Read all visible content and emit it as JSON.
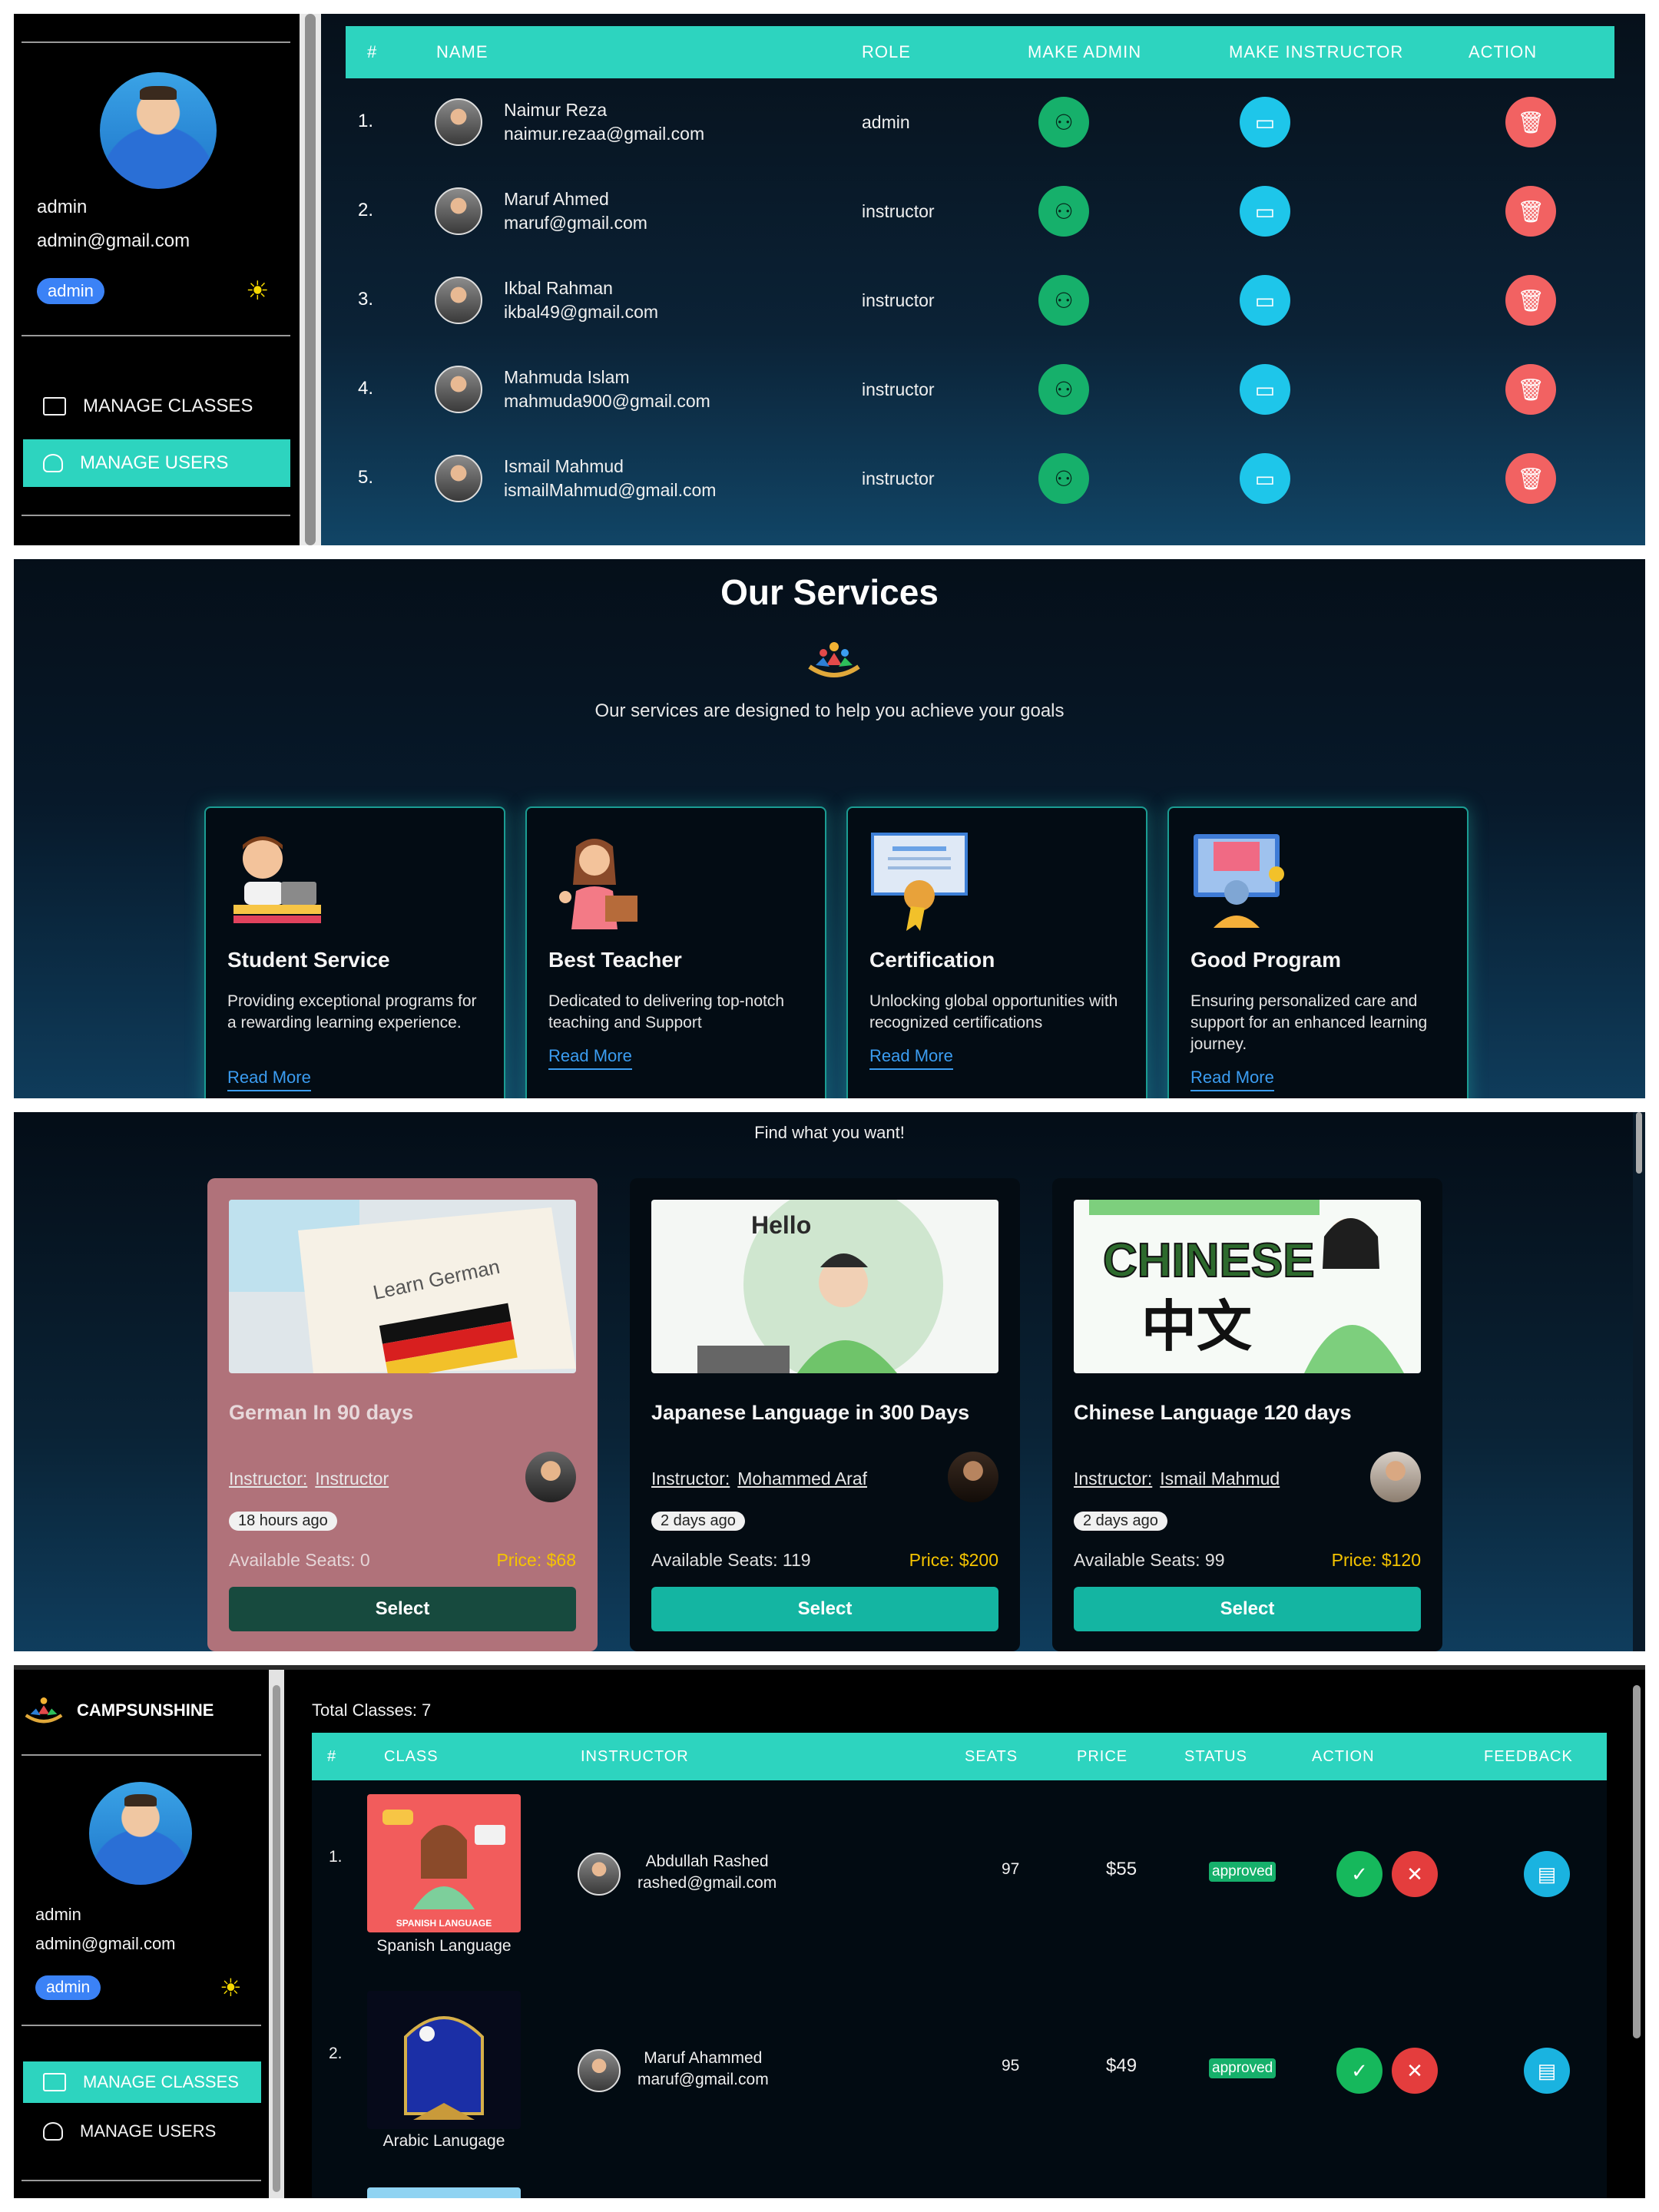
{
  "users_panel": {
    "sidebar": {
      "user_name": "admin",
      "user_email": "admin@gmail.com",
      "role_badge": "admin",
      "theme_icon": "sun-icon",
      "nav": [
        {
          "label": "MANAGE CLASSES",
          "icon": "classes-icon",
          "active": false
        },
        {
          "label": "MANAGE USERS",
          "icon": "users-icon",
          "active": true
        }
      ]
    },
    "table": {
      "headers": [
        "#",
        "NAME",
        "ROLE",
        "MAKE ADMIN",
        "MAKE INSTRUCTOR",
        "ACTION"
      ],
      "rows": [
        {
          "idx": "1.",
          "name": "Naimur Reza",
          "email": "naimur.rezaa@gmail.com",
          "role": "admin"
        },
        {
          "idx": "2.",
          "name": "Maruf Ahmed",
          "email": "maruf@gmail.com",
          "role": "instructor"
        },
        {
          "idx": "3.",
          "name": "Ikbal Rahman",
          "email": "ikbal49@gmail.com",
          "role": "instructor"
        },
        {
          "idx": "4.",
          "name": "Mahmuda Islam",
          "email": "mahmuda900@gmail.com",
          "role": "instructor"
        },
        {
          "idx": "5.",
          "name": "Ismail Mahmud",
          "email": "ismailMahmud@gmail.com",
          "role": "instructor"
        }
      ]
    },
    "colors": {
      "accent": "#2dd4bf",
      "make_admin": "#16b06b",
      "make_instructor": "#1ec6ea",
      "delete": "#f26262"
    }
  },
  "services_panel": {
    "title": "Our Services",
    "subtitle": "Our services are designed to help you achieve your goals",
    "cards": [
      {
        "title": "Student Service",
        "desc": "Providing exceptional programs for a rewarding learning experience.",
        "link": "Read More",
        "icon": "student-laptop-icon"
      },
      {
        "title": "Best Teacher",
        "desc": "Dedicated to delivering top-notch teaching and Support",
        "link": "Read More",
        "icon": "teacher-icon"
      },
      {
        "title": "Certification",
        "desc": "Unlocking global opportunities with recognized certifications",
        "link": "Read More",
        "icon": "certificate-icon"
      },
      {
        "title": "Good Program",
        "desc": "Ensuring personalized care and support for an enhanced learning journey.",
        "link": "Read More",
        "icon": "program-icon"
      }
    ]
  },
  "classes_panel": {
    "heading": "Find what you want!",
    "instructor_label": "Instructor:",
    "select_label": "Select",
    "cards": [
      {
        "title": "German In 90 days",
        "instructor": "Instructor",
        "time": "18 hours ago",
        "seats": "Available Seats: 0",
        "price": "Price: $68",
        "image": "learn-german-image",
        "image_text": "Learn German"
      },
      {
        "title": "Japanese Language in 300 Days",
        "instructor": "Mohammed Araf",
        "time": "2 days ago",
        "seats": "Available Seats: 119",
        "price": "Price: $200",
        "image": "languages-world-image",
        "image_text": "Hello"
      },
      {
        "title": "Chinese Language 120 days",
        "instructor": "Ismail Mahmud",
        "time": "2 days ago",
        "seats": "Available Seats: 99",
        "price": "Price: $120",
        "image": "chinese-image",
        "image_text": "CHINESE"
      }
    ]
  },
  "manage_classes_panel": {
    "brand": "CAMPSUNSHINE",
    "sidebar": {
      "user_name": "admin",
      "user_email": "admin@gmail.com",
      "role_badge": "admin",
      "nav": [
        {
          "label": "MANAGE CLASSES",
          "active": true
        },
        {
          "label": "MANAGE USERS",
          "active": false
        }
      ]
    },
    "total": "Total Classes: 7",
    "headers": [
      "#",
      "CLASS",
      "INSTRUCTOR",
      "SEATS",
      "PRICE",
      "STATUS",
      "ACTION",
      "FEEDBACK"
    ],
    "rows": [
      {
        "idx": "1.",
        "class": "Spanish Language",
        "thumb_text": "SPANISH LANGUAGE",
        "instructor": "Abdullah Rashed",
        "email": "rashed@gmail.com",
        "seats": "97",
        "price": "$55",
        "status": "approved"
      },
      {
        "idx": "2.",
        "class": "Arabic Lanugage",
        "thumb_text": "",
        "instructor": "Maruf Ahammed",
        "email": "maruf@gmail.com",
        "seats": "95",
        "price": "$49",
        "status": "approved"
      }
    ]
  }
}
